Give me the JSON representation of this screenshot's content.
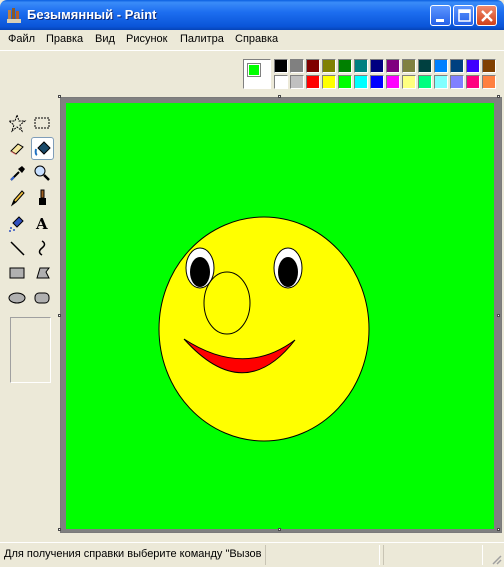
{
  "window": {
    "title": "Безымянный - Paint"
  },
  "menu": [
    "Файл",
    "Правка",
    "Вид",
    "Рисунок",
    "Палитра",
    "Справка"
  ],
  "colors": {
    "foreground": "#00ff00",
    "background": "#ffffff",
    "palette_top": [
      "#000000",
      "#808080",
      "#800000",
      "#808000",
      "#008000",
      "#008080",
      "#000080",
      "#800080",
      "#808040",
      "#004040",
      "#0080ff",
      "#004080",
      "#4000ff",
      "#804000"
    ],
    "palette_bottom": [
      "#ffffff",
      "#c0c0c0",
      "#ff0000",
      "#ffff00",
      "#00ff00",
      "#00ffff",
      "#0000ff",
      "#ff00ff",
      "#ffff80",
      "#00ff80",
      "#80ffff",
      "#8080ff",
      "#ff0080",
      "#ff8040"
    ]
  },
  "tools": [
    {
      "name": "free-form-select-icon",
      "active": false
    },
    {
      "name": "rect-select-icon",
      "active": false
    },
    {
      "name": "eraser-icon",
      "active": false
    },
    {
      "name": "fill-bucket-icon",
      "active": true
    },
    {
      "name": "color-picker-icon",
      "active": false
    },
    {
      "name": "magnifier-icon",
      "active": false
    },
    {
      "name": "pencil-icon",
      "active": false
    },
    {
      "name": "brush-icon",
      "active": false
    },
    {
      "name": "airbrush-icon",
      "active": false
    },
    {
      "name": "text-icon",
      "active": false
    },
    {
      "name": "line-icon",
      "active": false
    },
    {
      "name": "curve-icon",
      "active": false
    },
    {
      "name": "rectangle-icon",
      "active": false
    },
    {
      "name": "polygon-icon",
      "active": false
    },
    {
      "name": "ellipse-icon",
      "active": false
    },
    {
      "name": "rounded-rectangle-icon",
      "active": false
    }
  ],
  "text_tool_glyph": "A",
  "drawing": {
    "background": "#00ff00",
    "face_color": "#ffff00",
    "mouth_color": "#ff0000",
    "eye_white": "#ffffff",
    "pupil": "#000000"
  },
  "status": {
    "text": "Для получения справки выберите команду \"Вызов справки\" из меню \"Справка\"."
  }
}
